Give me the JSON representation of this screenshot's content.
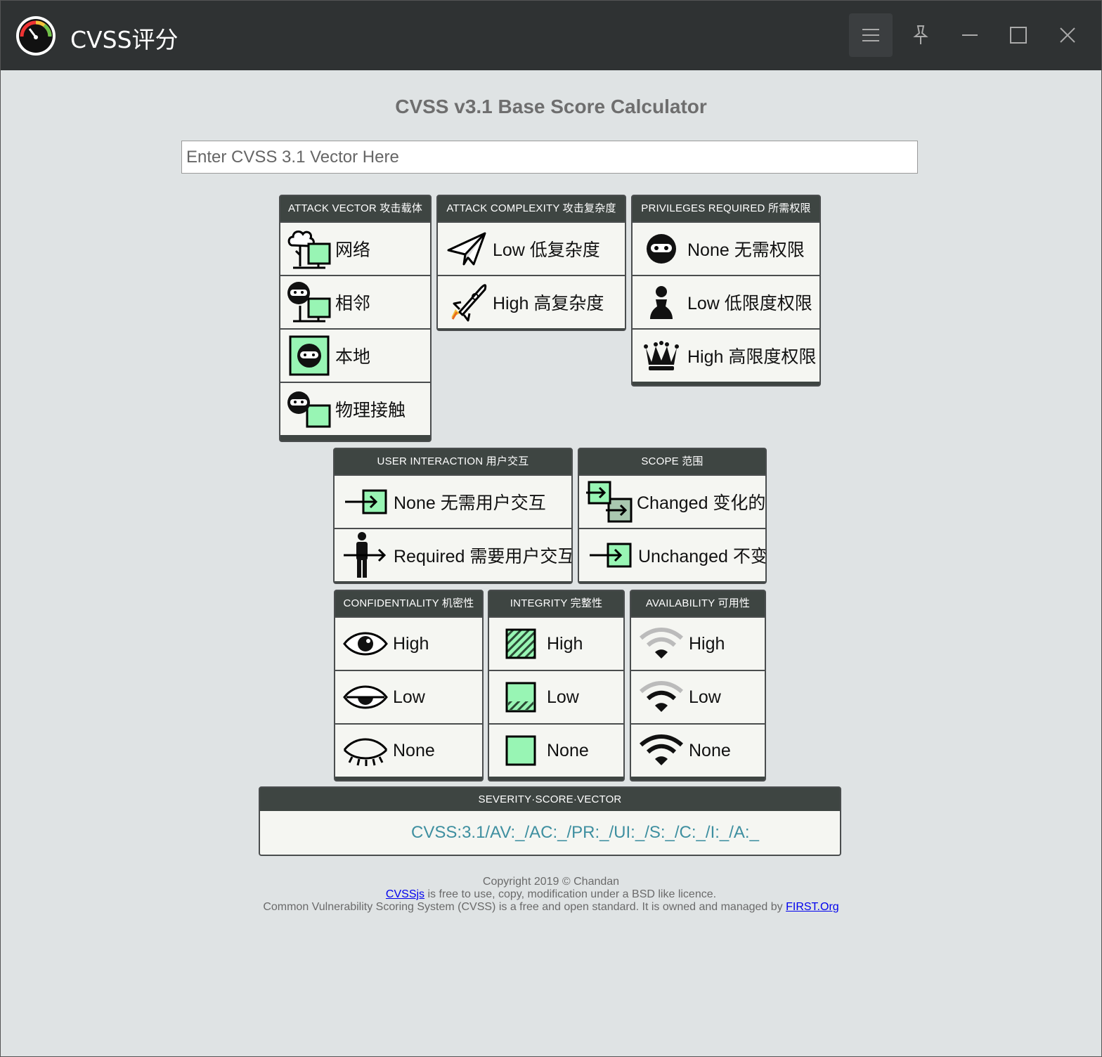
{
  "window": {
    "title": "CVSS评分",
    "controls": [
      "menu-icon",
      "pin-icon",
      "minimize-icon",
      "maximize-icon",
      "close-icon"
    ]
  },
  "page": {
    "heading": "CVSS v3.1 Base Score Calculator",
    "vector_input": {
      "placeholder": "Enter CVSS 3.1 Vector Here",
      "value": ""
    }
  },
  "groups": {
    "attack_vector": {
      "title": "ATTACK VECTOR 攻击载体",
      "options": [
        {
          "label": "网络",
          "icon": "network-icon"
        },
        {
          "label": "相邻",
          "icon": "adjacent-icon"
        },
        {
          "label": "本地",
          "icon": "local-icon"
        },
        {
          "label": "物理接触",
          "icon": "physical-icon"
        }
      ]
    },
    "attack_complexity": {
      "title": "ATTACK COMPLEXITY 攻击复杂度",
      "options": [
        {
          "label": "Low 低复杂度",
          "icon": "paper-plane-icon"
        },
        {
          "label": "High 高复杂度",
          "icon": "rocket-icon"
        }
      ]
    },
    "privileges_required": {
      "title": "PRIVILEGES REQUIRED 所需权限",
      "options": [
        {
          "label": "None 无需权限",
          "icon": "ninja-icon"
        },
        {
          "label": "Low 低限度权限",
          "icon": "pawn-icon"
        },
        {
          "label": "High 高限度权限",
          "icon": "crown-icon"
        }
      ]
    },
    "user_interaction": {
      "title": "USER INTERACTION 用户交互",
      "options": [
        {
          "label": "None 无需用户交互",
          "icon": "enter-arrow-icon"
        },
        {
          "label": "Required 需要用户交互",
          "icon": "person-arrow-icon"
        }
      ]
    },
    "scope": {
      "title": "SCOPE 范围",
      "options": [
        {
          "label": "Changed 变化的",
          "icon": "scope-changed-icon"
        },
        {
          "label": "Unchanged 不变",
          "icon": "enter-arrow-icon"
        }
      ]
    },
    "confidentiality": {
      "title": "CONFIDENTIALITY 机密性",
      "options": [
        {
          "label": "High",
          "icon": "eye-open-icon"
        },
        {
          "label": "Low",
          "icon": "eye-half-icon"
        },
        {
          "label": "None",
          "icon": "eye-closed-icon"
        }
      ]
    },
    "integrity": {
      "title": "INTEGRITY 完整性",
      "options": [
        {
          "label": "High",
          "icon": "square-hatched-full-icon"
        },
        {
          "label": "Low",
          "icon": "square-hatched-low-icon"
        },
        {
          "label": "None",
          "icon": "square-plain-icon"
        }
      ]
    },
    "availability": {
      "title": "AVAILABILITY 可用性",
      "options": [
        {
          "label": "High",
          "icon": "wifi-weak-icon"
        },
        {
          "label": "Low",
          "icon": "wifi-medium-icon"
        },
        {
          "label": "None",
          "icon": "wifi-full-icon"
        }
      ]
    }
  },
  "severity": {
    "title": "SEVERITY·SCORE·VECTOR",
    "vector": "CVSS:3.1/AV:_/AC:_/PR:_/UI:_/S:_/C:_/I:_/A:_"
  },
  "footer": {
    "copyright": "Copyright 2019 © Chandan",
    "cvssjs_link": "CVSSjs",
    "line2_rest": " is free to use, copy, modification under a BSD like licence.",
    "line3_text": "Common Vulnerability Scoring System (CVSS) is a free and open standard. It is owned and managed by ",
    "first_link": "FIRST.Org"
  },
  "colors": {
    "titlebar": "#2f3233",
    "background": "#dfe3e4",
    "group_header": "#3e4542",
    "option_bg": "#f5f6f2",
    "icon_green": "#98f5b4",
    "vector_text": "#3e8fa0"
  }
}
